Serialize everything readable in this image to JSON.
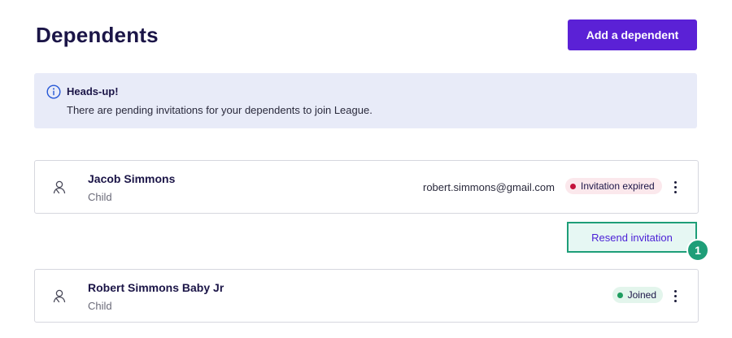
{
  "header": {
    "title": "Dependents",
    "add_button_label": "Add a dependent"
  },
  "banner": {
    "icon": "info-icon",
    "title": "Heads-up!",
    "text": "There are pending invitations for your dependents to join League."
  },
  "dependents": [
    {
      "name": "Jacob Simmons",
      "relation": "Child",
      "email": "robert.simmons@gmail.com",
      "status": "Invitation expired",
      "status_color": "#c4123b"
    },
    {
      "name": "Robert Simmons Baby Jr",
      "relation": "Child",
      "email": "",
      "status": "Joined",
      "status_color": "#1f9d5f"
    }
  ],
  "resend_button_label": "Resend invitation",
  "step_marker": "1",
  "colors": {
    "primary": "#5b21d6",
    "banner_bg": "#e8ebf8",
    "highlight": "#1e9e78"
  }
}
